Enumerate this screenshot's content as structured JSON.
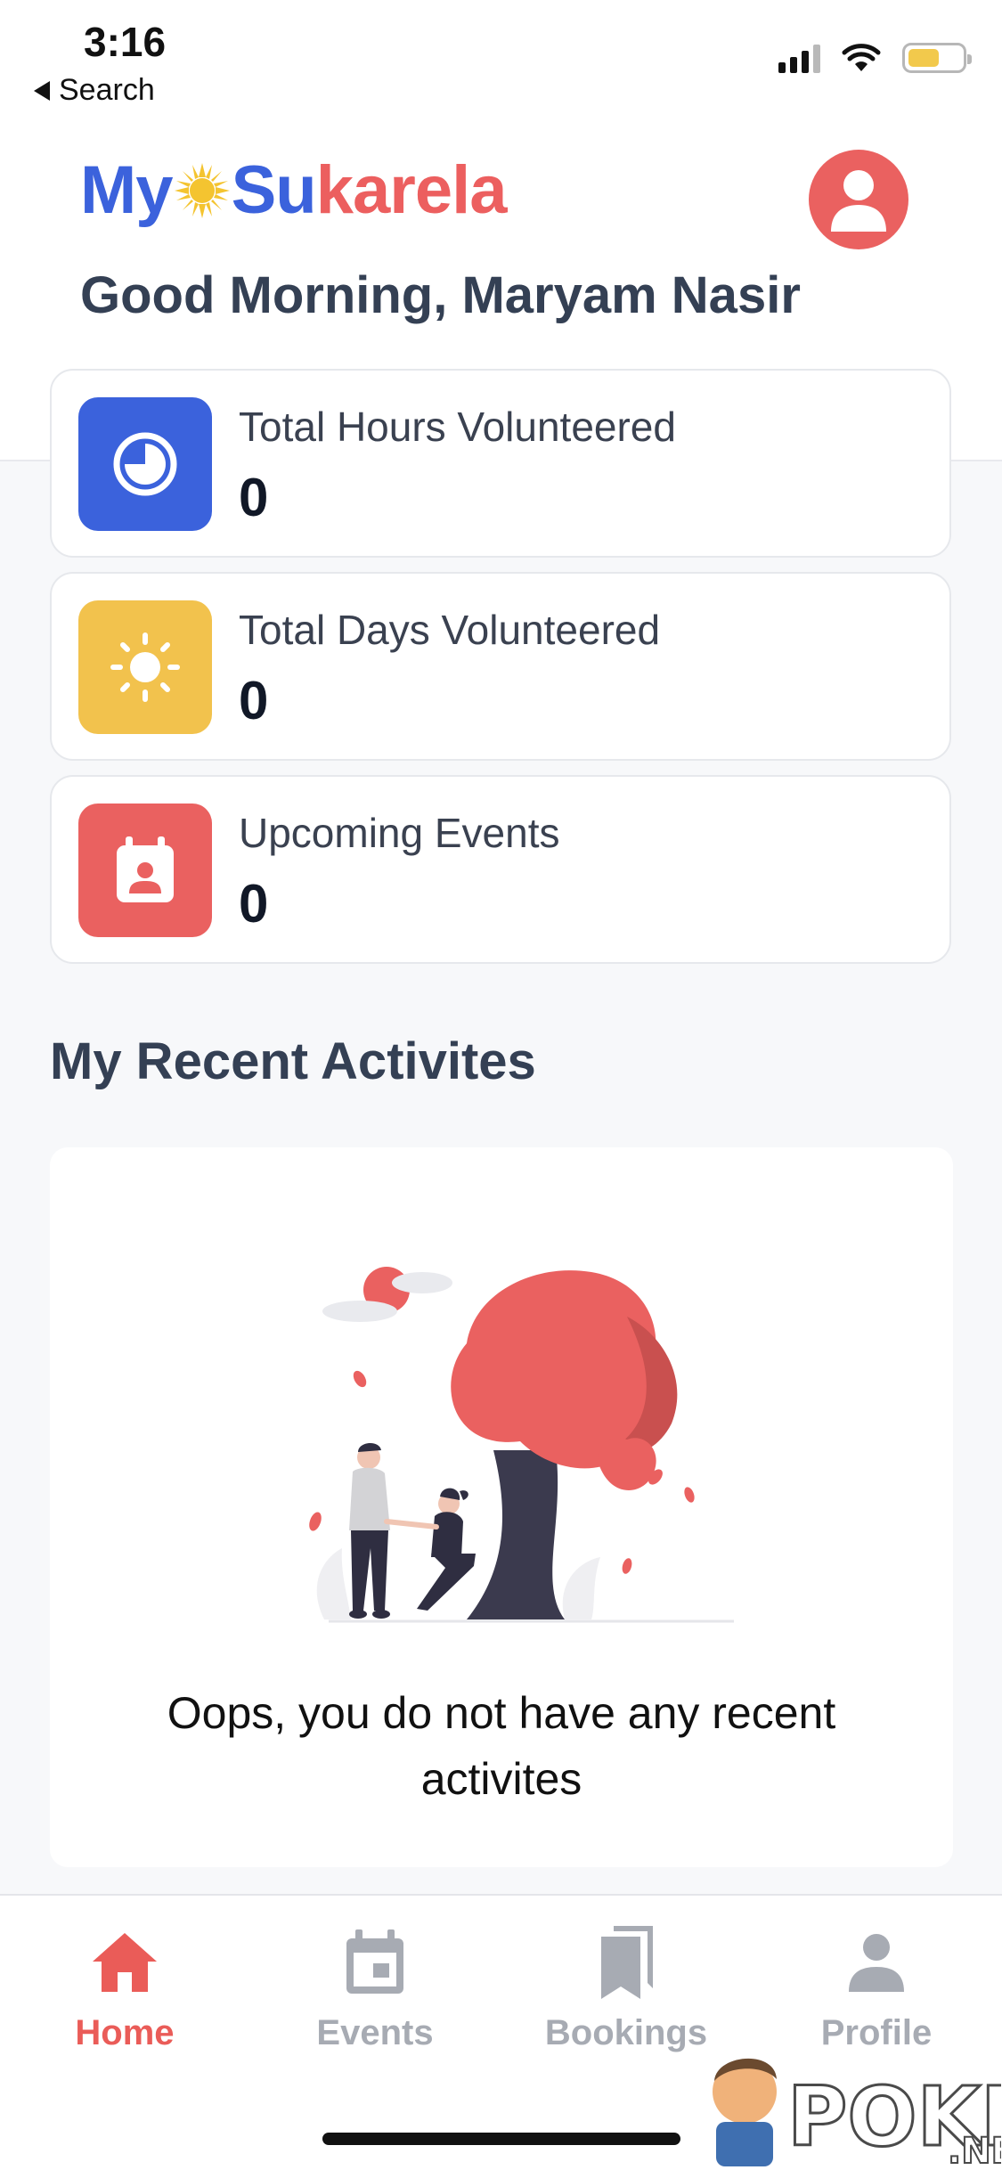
{
  "status_bar": {
    "time": "3:16",
    "back_label": "Search"
  },
  "header": {
    "logo_my": "My",
    "logo_su": "Su",
    "logo_karela": "karela",
    "greeting": "Good Morning, Maryam Nasir"
  },
  "stats": [
    {
      "label": "Total Hours Volunteered",
      "value": "0",
      "icon": "clock-icon",
      "color": "#3b62dc"
    },
    {
      "label": "Total Days Volunteered",
      "value": "0",
      "icon": "sun-icon",
      "color": "#f2c24d"
    },
    {
      "label": "Upcoming Events",
      "value": "0",
      "icon": "calendar-person-icon",
      "color": "#ea6160"
    }
  ],
  "recent": {
    "title": "My Recent Activites",
    "empty_message": "Oops, you do not have any recent activites"
  },
  "nav": [
    {
      "label": "Home",
      "icon": "home-icon",
      "active": true
    },
    {
      "label": "Events",
      "icon": "calendar-icon",
      "active": false
    },
    {
      "label": "Bookings",
      "icon": "bookmarks-icon",
      "active": false
    },
    {
      "label": "Profile",
      "icon": "person-icon",
      "active": false
    }
  ],
  "colors": {
    "accent": "#ea5c58",
    "brand_blue": "#3b62dc",
    "inactive": "#a7abb3"
  },
  "watermark": "POKDE.NET"
}
